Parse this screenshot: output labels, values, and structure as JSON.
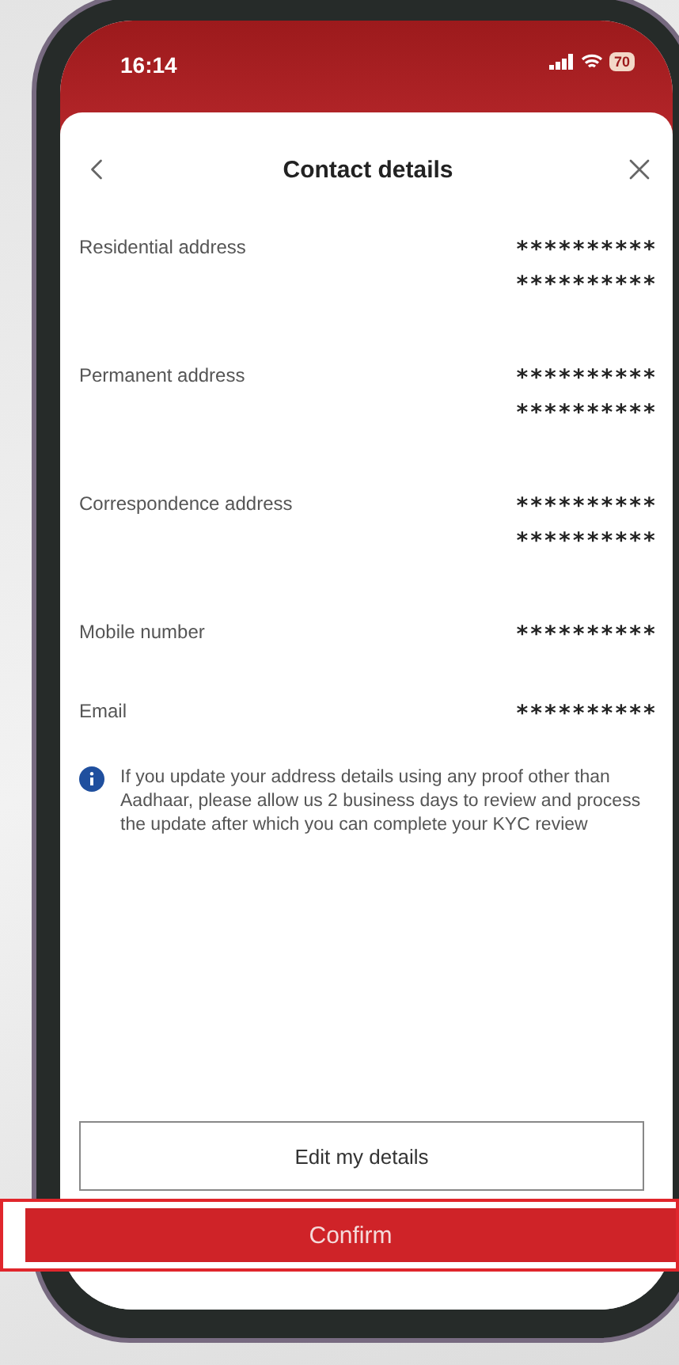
{
  "status_bar": {
    "time": "16:14",
    "battery": "70"
  },
  "header": {
    "title": "Contact details"
  },
  "rows": [
    {
      "label": "Residential address",
      "value_lines": [
        "**********",
        "**********"
      ]
    },
    {
      "label": "Permanent address",
      "value_lines": [
        "**********",
        "**********"
      ]
    },
    {
      "label": "Correspondence address",
      "value_lines": [
        "**********",
        "**********"
      ]
    },
    {
      "label": "Mobile number",
      "value_lines": [
        "**********"
      ]
    },
    {
      "label": "Email",
      "value_lines": [
        "**********"
      ]
    }
  ],
  "info": {
    "text": "If you update your address details using any proof other than Aadhaar, please allow us 2 business days to review and process the update after which you can complete your KYC review"
  },
  "buttons": {
    "edit": "Edit my details",
    "confirm": "Confirm"
  }
}
